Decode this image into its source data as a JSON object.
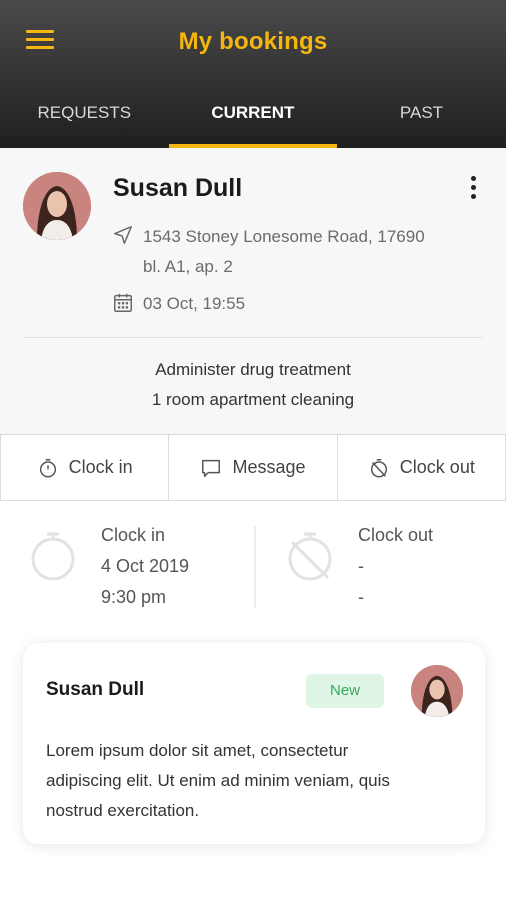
{
  "header": {
    "title": "My bookings",
    "menu_icon": "hamburger-menu-icon",
    "accent_color": "#f5b70f"
  },
  "tabs": [
    {
      "label": "REQUESTS",
      "active": false
    },
    {
      "label": "CURRENT",
      "active": true
    },
    {
      "label": "PAST",
      "active": false
    }
  ],
  "booking": {
    "client_name": "Susan Dull",
    "address_line1": "1543 Stoney Lonesome Road, 17690",
    "address_line2": "bl. A1, ap. 2",
    "datetime": "03 Oct, 19:55",
    "services": [
      "Administer drug treatment",
      "1 room apartment cleaning"
    ]
  },
  "actions": {
    "clock_in": "Clock in",
    "message": "Message",
    "clock_out": "Clock out"
  },
  "clock": {
    "in_label": "Clock in",
    "in_date": "4 Oct 2019",
    "in_time": "9:30 pm",
    "out_label": "Clock out",
    "out_date": "-",
    "out_time": "-"
  },
  "message_card": {
    "name": "Susan Dull",
    "badge": "New",
    "badge_color": "#3aa75d",
    "text_line1": "Lorem ipsum dolor sit amet, consectetur",
    "text_line2": "adipiscing elit. Ut enim ad minim veniam, quis",
    "text_line3": "nostrud exercitation."
  }
}
